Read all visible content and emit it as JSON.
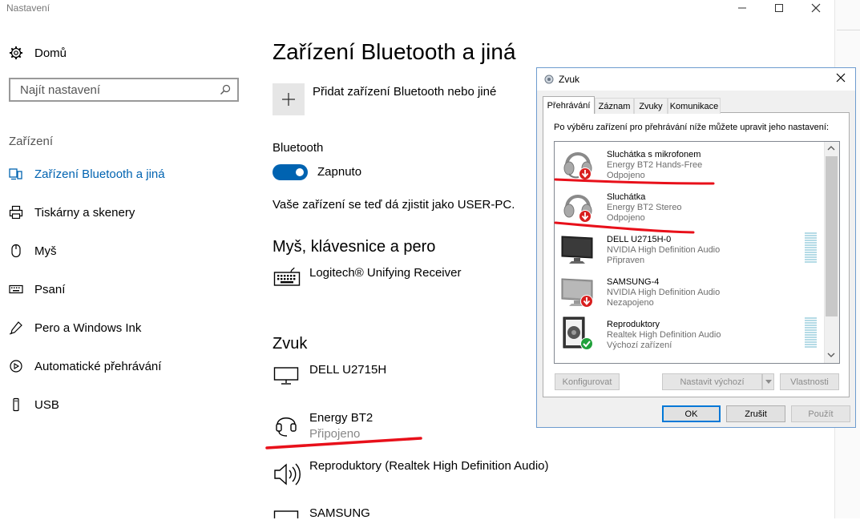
{
  "app": {
    "title": "Nastavení"
  },
  "sidebar": {
    "home": "Domů",
    "search_placeholder": "Najít nastavení",
    "section": "Zařízení",
    "items": [
      {
        "label": "Zařízení Bluetooth a jiná",
        "icon": "bluetooth-devices-icon",
        "active": true
      },
      {
        "label": "Tiskárny a skenery",
        "icon": "printer-icon"
      },
      {
        "label": "Myš",
        "icon": "mouse-icon"
      },
      {
        "label": "Psaní",
        "icon": "keyboard-icon"
      },
      {
        "label": "Pero a Windows Ink",
        "icon": "pen-icon"
      },
      {
        "label": "Automatické přehrávání",
        "icon": "autoplay-icon"
      },
      {
        "label": "USB",
        "icon": "usb-icon"
      }
    ]
  },
  "main": {
    "title": "Zařízení Bluetooth a jiná",
    "add_label": "Přidat zařízení Bluetooth nebo jiné",
    "bluetooth_label": "Bluetooth",
    "toggle_state": "Zapnuto",
    "discover_text": "Vaše zařízení se teď dá zjistit jako USER-PC.",
    "mouse_section": "Myš, klávesnice a pero",
    "mouse_devices": [
      {
        "name": "Logitech® Unifying Receiver",
        "icon": "keyboard-icon"
      }
    ],
    "sound_section": "Zvuk",
    "sound_devices": [
      {
        "name": "DELL U2715H",
        "icon": "monitor-icon"
      },
      {
        "name": "Energy BT2",
        "status": "Připojeno",
        "icon": "headset-icon"
      },
      {
        "name": "Reproduktory (Realtek High Definition Audio)",
        "icon": "speaker-icon"
      },
      {
        "name": "SAMSUNG",
        "icon": "monitor-icon"
      }
    ]
  },
  "dialog": {
    "title": "Zvuk",
    "tabs": [
      "Přehrávání",
      "Záznam",
      "Zvuky",
      "Komunikace"
    ],
    "instruction": "Po výběru zařízení pro přehrávání níže můžete upravit jeho nastavení:",
    "devices": [
      {
        "name": "Sluchátka s mikrofonem",
        "driver": "Energy BT2 Hands-Free",
        "status": "Odpojeno",
        "icon": "headset-icon",
        "badge": "disconnected"
      },
      {
        "name": "Sluchátka",
        "driver": "Energy BT2 Stereo",
        "status": "Odpojeno",
        "icon": "headphones-icon",
        "badge": "disconnected"
      },
      {
        "name": "DELL U2715H-0",
        "driver": "NVIDIA High Definition Audio",
        "status": "Připraven",
        "icon": "monitor-icon",
        "badge": "none"
      },
      {
        "name": "SAMSUNG-4",
        "driver": "NVIDIA High Definition Audio",
        "status": "Nezapojeno",
        "icon": "monitor-icon",
        "badge": "disconnected"
      },
      {
        "name": "Reproduktory",
        "driver": "Realtek High Definition Audio",
        "status": "Výchozí zařízení",
        "icon": "speaker-icon",
        "badge": "default"
      }
    ],
    "buttons": {
      "configure": "Konfigurovat",
      "set_default": "Nastavit výchozí",
      "properties": "Vlastnosti",
      "ok": "OK",
      "cancel": "Zrušit",
      "apply": "Použít"
    }
  },
  "colors": {
    "accent": "#0063b1",
    "annotation": "#e8101a"
  }
}
